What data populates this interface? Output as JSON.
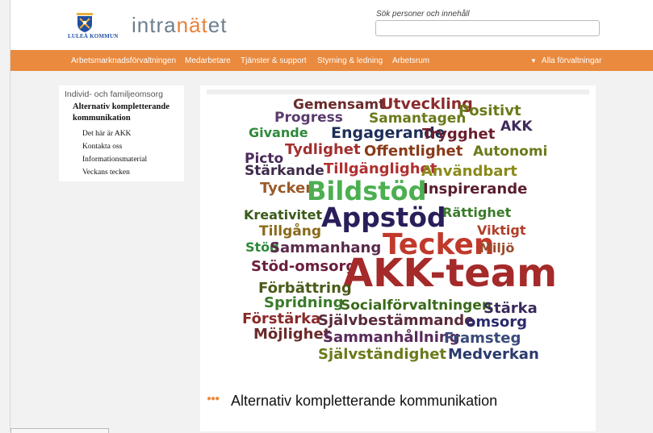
{
  "header": {
    "logo_text": "LULEÅ KOMMUN",
    "brand_prefix": "intra",
    "brand_accent": "nät",
    "brand_suffix": "et",
    "search_label": "Sök personer och innehåll",
    "search_value": ""
  },
  "nav": {
    "items": [
      "Arbetsmarknadsförvaltningen",
      "Medarbetare",
      "Tjänster & support",
      "Styrning & ledning",
      "Arbetsrum"
    ],
    "right_label": "Alla förvaltningar"
  },
  "sidebar": {
    "parent": "Individ- och familjeomsorg",
    "current": "Alternativ kompletterande kommunikation",
    "subitems": [
      "Det här är AKK",
      "Kontakta oss",
      "Informationsmaterial",
      "Veckans tecken"
    ]
  },
  "wordcloud": {
    "words": [
      {
        "text": "Gemensamt",
        "color": "#6b2a2a"
      },
      {
        "text": "Utveckling",
        "color": "#8a2b2b"
      },
      {
        "text": "Positivt",
        "color": "#6b7a1a"
      },
      {
        "text": "Progress",
        "color": "#5a3a6e"
      },
      {
        "text": "Samantagen",
        "color": "#6b7a1a"
      },
      {
        "text": "AKK",
        "color": "#3e2a5a"
      },
      {
        "text": "Givande",
        "color": "#2e8a3a"
      },
      {
        "text": "Engagerande",
        "color": "#1e2e5a"
      },
      {
        "text": "Trygghet",
        "color": "#6b1e2e"
      },
      {
        "text": "Tydlighet",
        "color": "#a33030"
      },
      {
        "text": "Offentlighet",
        "color": "#8a3a1a"
      },
      {
        "text": "Autonomi",
        "color": "#6b7a1a"
      },
      {
        "text": "Picto",
        "color": "#4a2a5a"
      },
      {
        "text": "Stärkande",
        "color": "#3e2a4a"
      },
      {
        "text": "Tillgänglighet",
        "color": "#b03030"
      },
      {
        "text": "Användbart",
        "color": "#8a8a1a"
      },
      {
        "text": "Tycker",
        "color": "#9a5a2a"
      },
      {
        "text": "Bildstöd",
        "color": "#4caf50"
      },
      {
        "text": "Inspirerande",
        "color": "#5a1e2e"
      },
      {
        "text": "Kreativitet",
        "color": "#3a5a1a"
      },
      {
        "text": "Appstöd",
        "color": "#2a1e5a"
      },
      {
        "text": "Rättighet",
        "color": "#3a7a2a"
      },
      {
        "text": "Tillgång",
        "color": "#8a6a1a"
      },
      {
        "text": "Viktigt",
        "color": "#b0402a"
      },
      {
        "text": "Stöd",
        "color": "#2e8a3a"
      },
      {
        "text": "Sammanhang",
        "color": "#5a2a4a"
      },
      {
        "text": "Tecken",
        "color": "#c0392b"
      },
      {
        "text": "Miljö",
        "color": "#9a4a2a"
      },
      {
        "text": "Stöd-omsorg",
        "color": "#6b1e3e"
      },
      {
        "text": "AKK-team",
        "color": "#a52a2a"
      },
      {
        "text": "Förbättring",
        "color": "#4a5a1a"
      },
      {
        "text": "Spridning",
        "color": "#3a7a2a"
      },
      {
        "text": "Socialförvaltningen",
        "color": "#3a6a1a"
      },
      {
        "text": "Stärka",
        "color": "#3a2a5a"
      },
      {
        "text": "Förstärka",
        "color": "#8a2a2a"
      },
      {
        "text": "Självbestämmande",
        "color": "#5a2a3a"
      },
      {
        "text": "omsorg",
        "color": "#2a2a6e"
      },
      {
        "text": "Möjlighet",
        "color": "#6b2a2a"
      },
      {
        "text": "Sammanhållning",
        "color": "#5a2a5a"
      },
      {
        "text": "Framsteg",
        "color": "#3a4a7a"
      },
      {
        "text": "Självständighet",
        "color": "#6b7a1a"
      },
      {
        "text": "Medverkan",
        "color": "#2a3a6e"
      }
    ]
  },
  "main": {
    "title": "Alternativ kompletterande kommunikation"
  },
  "colors": {
    "nav_bg": "#e98a3f",
    "brand_accent": "#e8813a",
    "brand_text": "#6d7f8e"
  }
}
